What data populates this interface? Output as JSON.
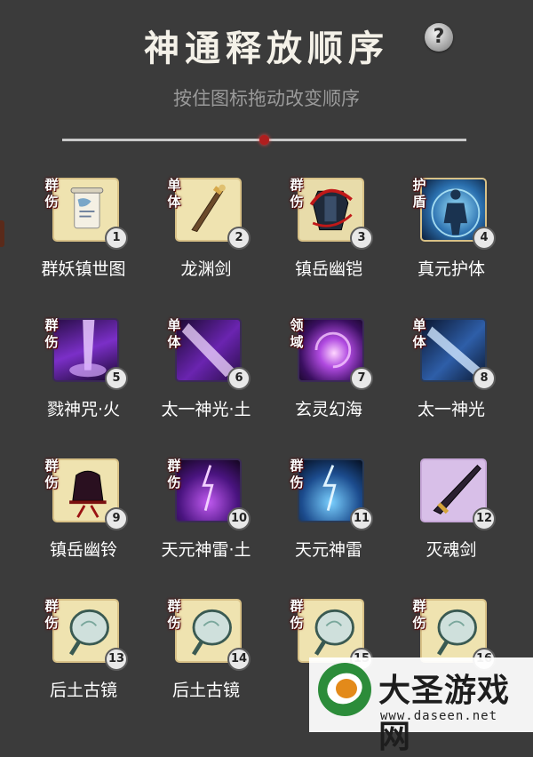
{
  "header": {
    "title": "神通释放顺序",
    "help_label": "?",
    "subtitle": "按住图标拖动改变顺序"
  },
  "skills": [
    {
      "name": "群妖镇世图",
      "tag1": "群",
      "tag2": "伤",
      "order": "1",
      "icon": "scroll-icon"
    },
    {
      "name": "龙渊剑",
      "tag1": "单",
      "tag2": "体",
      "order": "2",
      "icon": "sword-icon"
    },
    {
      "name": "镇岳幽铠",
      "tag1": "群",
      "tag2": "伤",
      "order": "3",
      "icon": "armor-icon"
    },
    {
      "name": "真元护体",
      "tag1": "护",
      "tag2": "盾",
      "order": "4",
      "icon": "shield-aura-icon"
    },
    {
      "name": "戮神咒·火",
      "tag1": "群",
      "tag2": "伤",
      "order": "5",
      "icon": "purple-beam-icon"
    },
    {
      "name": "太一神光·土",
      "tag1": "单",
      "tag2": "体",
      "order": "6",
      "icon": "purple-slash-icon"
    },
    {
      "name": "玄灵幻海",
      "tag1": "领",
      "tag2": "域",
      "order": "7",
      "icon": "purple-vortex-icon"
    },
    {
      "name": "太一神光",
      "tag1": "单",
      "tag2": "体",
      "order": "8",
      "icon": "blue-slash-icon"
    },
    {
      "name": "镇岳幽铃",
      "tag1": "群",
      "tag2": "伤",
      "order": "9",
      "icon": "bell-icon"
    },
    {
      "name": "天元神雷·土",
      "tag1": "群",
      "tag2": "伤",
      "order": "10",
      "icon": "purple-lightning-icon"
    },
    {
      "name": "天元神雷",
      "tag1": "群",
      "tag2": "伤",
      "order": "11",
      "icon": "blue-lightning-icon"
    },
    {
      "name": "灭魂剑",
      "tag1": "",
      "tag2": "",
      "order": "12",
      "icon": "dark-sword-icon"
    },
    {
      "name": "后土古镜",
      "tag1": "群",
      "tag2": "伤",
      "order": "13",
      "icon": "mirror-icon"
    },
    {
      "name": "后土古镜",
      "tag1": "群",
      "tag2": "伤",
      "order": "14",
      "icon": "mirror-icon"
    },
    {
      "name": "后",
      "tag1": "群",
      "tag2": "伤",
      "order": "15",
      "icon": "mirror-icon"
    },
    {
      "name": "",
      "tag1": "群",
      "tag2": "伤",
      "order": "16",
      "icon": "mirror-icon"
    }
  ],
  "watermark": {
    "name": "大圣游戏网",
    "url": "www.daseen.net"
  },
  "colors": {
    "background": "#3b3b3b",
    "frame_gold": "#d8c187",
    "slider_knob": "#b01e1e",
    "watermark_green": "#2c8c3a"
  }
}
